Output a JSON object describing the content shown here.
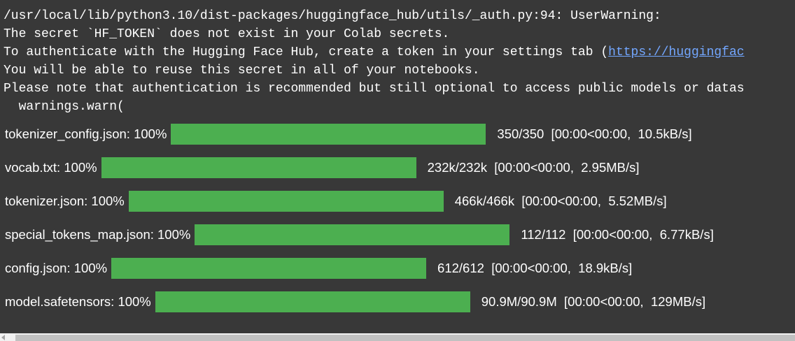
{
  "warning": {
    "line1": "/usr/local/lib/python3.10/dist-packages/huggingface_hub/utils/_auth.py:94: UserWarning:",
    "line2": "The secret `HF_TOKEN` does not exist in your Colab secrets.",
    "line3_text": "To authenticate with the Hugging Face Hub, create a token in your settings tab (",
    "line3_link": "https://huggingfac",
    "line4": "You will be able to reuse this secret in all of your notebooks.",
    "line5": "Please note that authentication is recommended but still optional to access public models or datas",
    "line6": "  warnings.warn("
  },
  "downloads": [
    {
      "label": "tokenizer_config.json: 100%",
      "progress": 1.0,
      "stats": "350/350  [00:00<00:00,  10.5kB/s]"
    },
    {
      "label": "vocab.txt: 100%",
      "progress": 1.0,
      "stats": "232k/232k  [00:00<00:00,  2.95MB/s]"
    },
    {
      "label": "tokenizer.json: 100%",
      "progress": 1.0,
      "stats": "466k/466k  [00:00<00:00,  5.52MB/s]"
    },
    {
      "label": "special_tokens_map.json: 100%",
      "progress": 1.0,
      "stats": "112/112  [00:00<00:00,  6.77kB/s]"
    },
    {
      "label": "config.json: 100%",
      "progress": 1.0,
      "stats": "612/612  [00:00<00:00,  18.9kB/s]"
    },
    {
      "label": "model.safetensors: 100%",
      "progress": 1.0,
      "stats": "90.9M/90.9M  [00:00<00:00,  129MB/s]"
    }
  ],
  "colors": {
    "background": "#383838",
    "text": "#ffffff",
    "link": "#73a7ff",
    "bar": "#4caf50"
  },
  "icons": {
    "scroll_left": "scroll-left-arrow-icon"
  }
}
